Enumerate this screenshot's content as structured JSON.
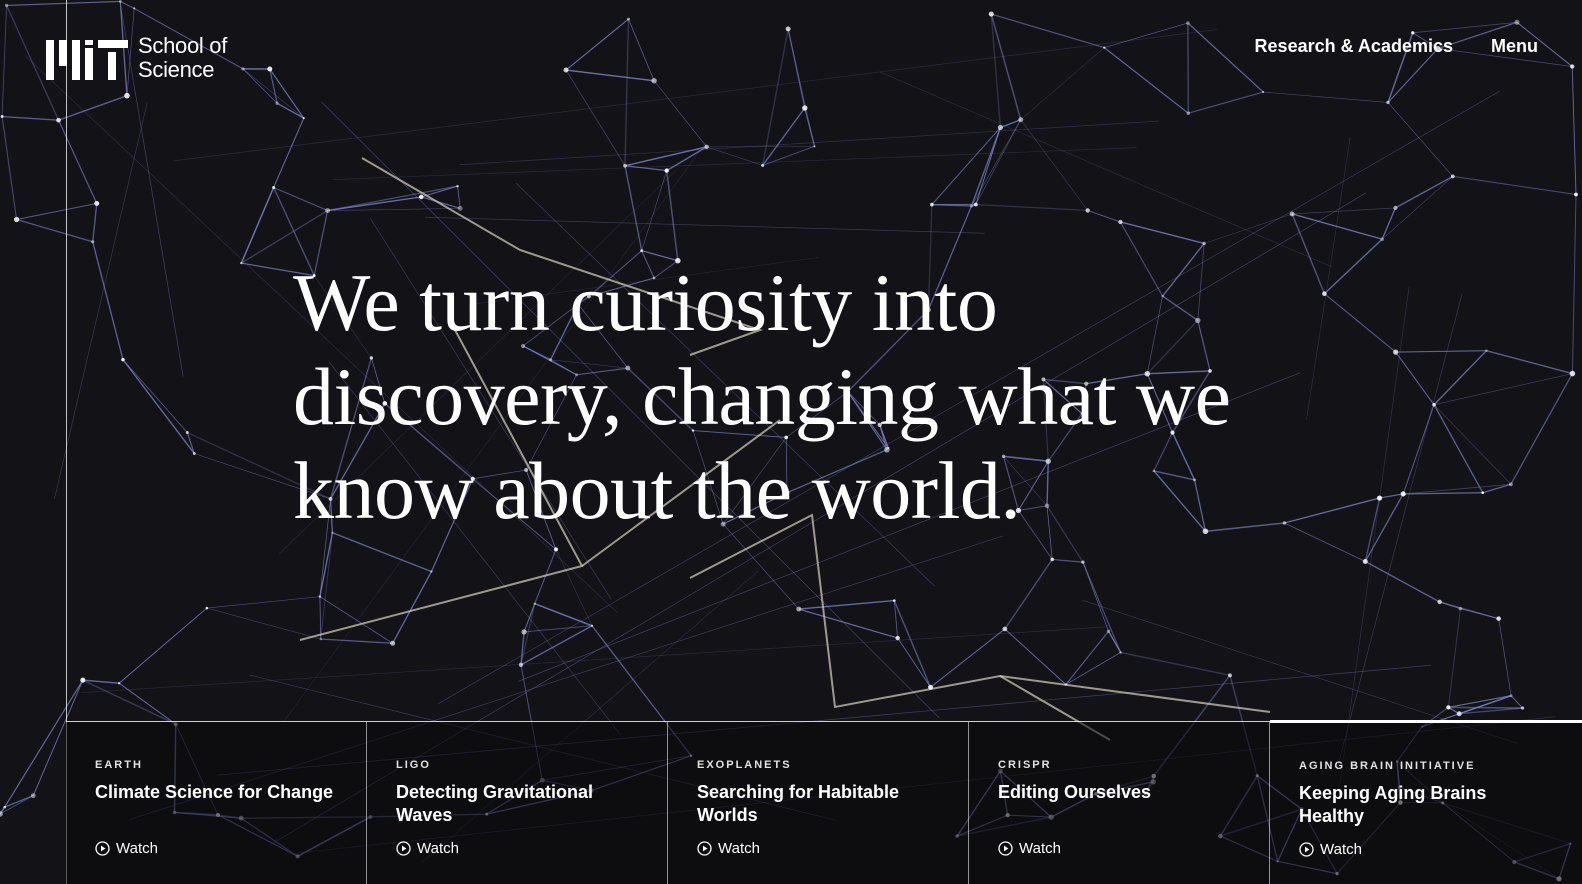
{
  "header": {
    "logo_text": "School of Science",
    "nav": [
      {
        "label": "Research & Academics"
      },
      {
        "label": "Menu"
      }
    ]
  },
  "hero": {
    "headline": "We turn curiosity into discovery, changing what we know about the world."
  },
  "cards": [
    {
      "kicker": "EARTH",
      "title": "Climate Science for Change",
      "action": "Watch"
    },
    {
      "kicker": "LIGO",
      "title": "Detecting Gravitational Waves",
      "action": "Watch"
    },
    {
      "kicker": "EXOPLANETS",
      "title": "Searching for Habitable Worlds",
      "action": "Watch"
    },
    {
      "kicker": "CRISPR",
      "title": "Editing Ourselves",
      "action": "Watch"
    },
    {
      "kicker": "AGING BRAIN INITIATIVE",
      "title": "Keeping Aging Brains Healthy",
      "action": "Watch"
    }
  ],
  "colors": {
    "background": "#131216",
    "network_line": "#7c82c8",
    "highlight_line": "#d8d4c0",
    "text": "#ffffff"
  }
}
